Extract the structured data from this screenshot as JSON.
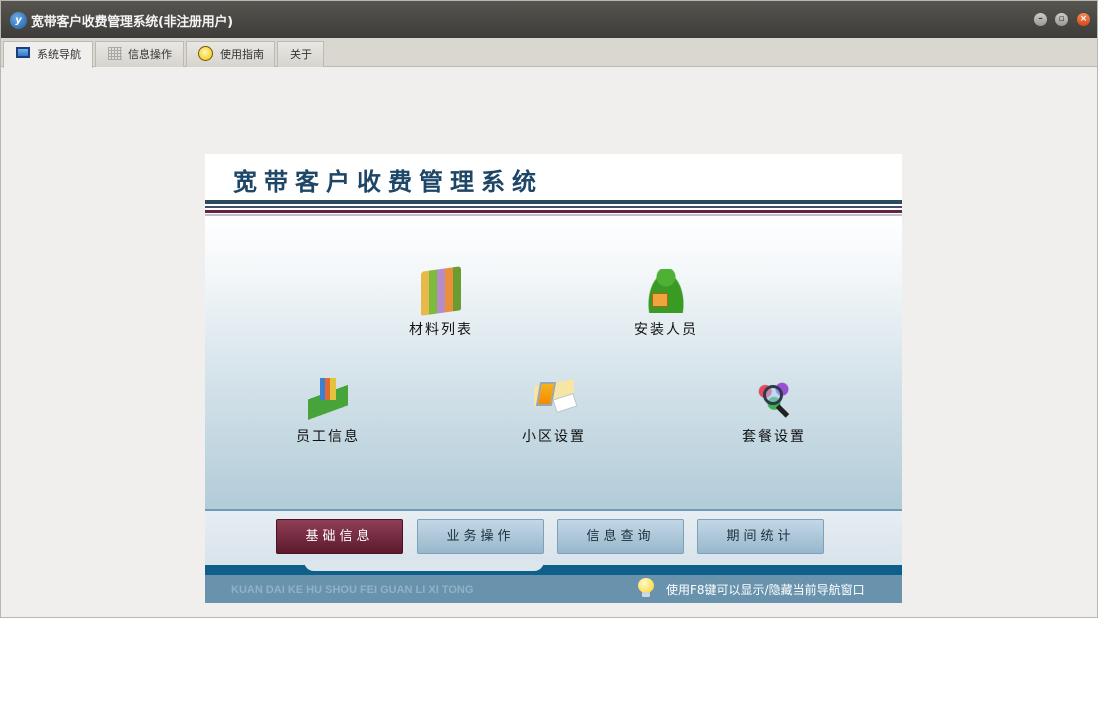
{
  "window": {
    "title": "宽带客户收费管理系统(非注册用户)",
    "app_icon_text": "y",
    "controls": {
      "minimize_icon": "minimize-icon",
      "maximize_icon": "maximize-icon",
      "close_icon": "close-icon"
    }
  },
  "tabs": [
    {
      "label": "系统导航",
      "icon": "monitor-icon",
      "active": true
    },
    {
      "label": "信息操作",
      "icon": "grid-icon",
      "active": false
    },
    {
      "label": "使用指南",
      "icon": "lightbulb-icon",
      "active": false
    },
    {
      "label": "关于",
      "icon": "",
      "active": false
    }
  ],
  "panel": {
    "banner_title": "宽带客户收费管理系统",
    "nav_items": [
      {
        "label": "材料列表",
        "icon": "books-icon"
      },
      {
        "label": "安装人员",
        "icon": "installer-person-icon"
      },
      {
        "label": "员工信息",
        "icon": "employee-ruler-icon"
      },
      {
        "label": "小区设置",
        "icon": "laptop-document-icon"
      },
      {
        "label": "套餐设置",
        "icon": "magnifier-icon"
      }
    ],
    "footer_tabs": [
      {
        "label": "基础信息",
        "active": true
      },
      {
        "label": "业务操作",
        "active": false
      },
      {
        "label": "信息查询",
        "active": false
      },
      {
        "label": "期间统计",
        "active": false
      }
    ],
    "bottom_left_text": "KUAN DAI KE HU SHOU FEI GUAN LI XI TONG",
    "bottom_hint": "使用F8键可以显示/隐藏当前导航窗口"
  },
  "colors": {
    "banner_title": "#1d4667",
    "active_footer_tab": "#6b2140",
    "footer_tab": "#b0c9da",
    "bottom_bar": "#6993ad"
  }
}
